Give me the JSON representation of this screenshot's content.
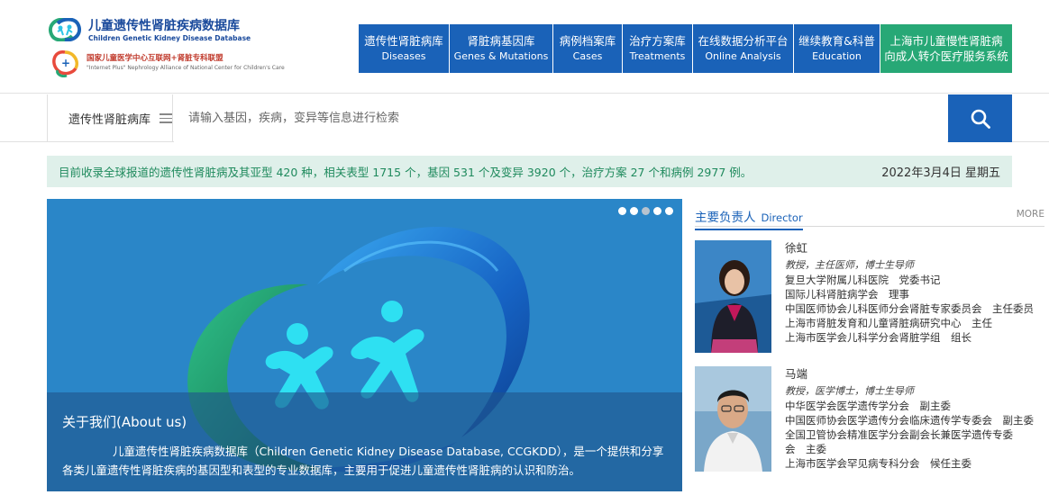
{
  "header": {
    "logo_cn": "儿童遗传性肾脏疾病数据库",
    "logo_en": "Children Genetic Kidney Disease Database",
    "alliance_cn": "国家儿童医学中心互联网+肾脏专科联盟",
    "alliance_en": "\"Internet Plus\" Nephrology Alliance of National Center for Children's Care"
  },
  "nav": [
    {
      "cn": "遗传性肾脏病库",
      "en": "Diseases"
    },
    {
      "cn": "肾脏病基因库",
      "en": "Genes & Mutations"
    },
    {
      "cn": "病例档案库",
      "en": "Cases"
    },
    {
      "cn": "治疗方案库",
      "en": "Treatments"
    },
    {
      "cn": "在线数据分析平台",
      "en": "Online Analysis"
    },
    {
      "cn": "继续教育&科普",
      "en": "Education"
    },
    {
      "cn": "上海市儿童慢性肾脏病",
      "en": "向成人转介医疗服务系统"
    }
  ],
  "search": {
    "category": "遗传性肾脏病库",
    "placeholder": "请输入基因，疾病，变异等信息进行检索"
  },
  "info": {
    "text": "目前收录全球报道的遗传性肾脏病及其亚型 420 种，相关表型 1715 个，基因 531 个及变异 3920 个，治疗方案 27 个和病例 2977 例。",
    "date": "2022年3月4日 星期五"
  },
  "banner": {
    "slide_count": 5,
    "active_slide": 3,
    "about_title": "关于我们(About us)",
    "about_text": "儿童遗传性肾脏疾病数据库（Children Genetic Kidney Disease Database, CCGKDD），是一个提供和分享各类儿童遗传性肾脏疾病的基因型和表型的专业数据库，主要用于促进儿童遗传性肾脏病的认识和防治。"
  },
  "directors": {
    "title_cn": "主要负责人",
    "title_en": "Director",
    "more": "MORE",
    "people": [
      {
        "name": "徐虹",
        "role": "教授，主任医师，博士生导师",
        "lines": [
          "复旦大学附属儿科医院　党委书记",
          "国际儿科肾脏病学会　理事",
          "中国医师协会儿科医师分会肾脏专家委员会　主任委员",
          "上海市肾脏发育和儿童肾脏病研究中心　主任",
          "上海市医学会儿科学分会肾脏学组　组长"
        ]
      },
      {
        "name": "马端",
        "role": "教授，医学博士，博士生导师",
        "lines": [
          "中华医学会医学遗传学分会　副主委",
          "中国医师协会医学遗传分会临床遗传学专委会　副主委",
          "全国卫管协会精准医学分会副会长兼医学遗传专委",
          "会　主委",
          "上海市医学会罕见病专科分会　候任主委"
        ]
      }
    ]
  },
  "colors": {
    "nav_blue": "#1a62b8",
    "nav_green": "#27a876",
    "banner_bg": "#2a86c8",
    "info_bg": "#dff0ea",
    "info_text": "#1f8a5d"
  }
}
